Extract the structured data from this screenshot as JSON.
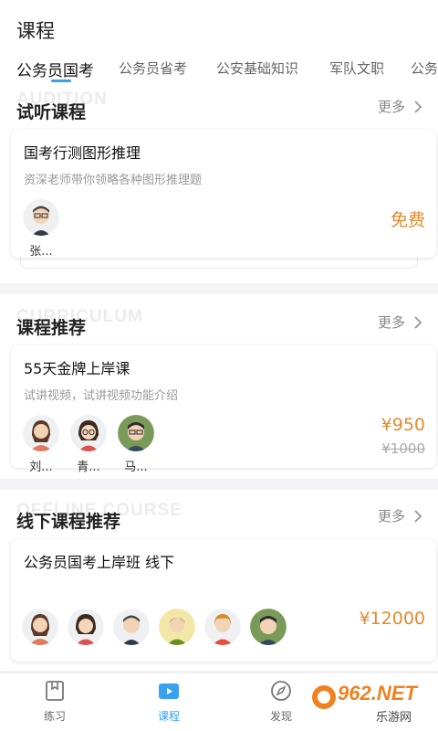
{
  "header": {
    "title": "课程"
  },
  "tabs": [
    {
      "label": "公务员国考",
      "active": true
    },
    {
      "label": "公务员省考",
      "active": false
    },
    {
      "label": "公安基础知识",
      "active": false
    },
    {
      "label": "军队文职",
      "active": false
    },
    {
      "label": "公务",
      "active": false
    }
  ],
  "more_label": "更多",
  "sections": {
    "trial": {
      "ghost": "AUDITION",
      "title": "试听课程",
      "card": {
        "title": "国考行测图形推理",
        "subtitle": "资深老师带你领略各种图形推理题",
        "teachers": [
          "张..."
        ],
        "price": "免费"
      }
    },
    "recommend": {
      "ghost": "CURRICULUM",
      "title": "课程推荐",
      "card": {
        "title": "55天金牌上岸课",
        "subtitle": "试讲视频，试讲视频功能介绍",
        "teachers": [
          "刘...",
          "青...",
          "马..."
        ],
        "price": "¥950",
        "original_price": "¥1000"
      }
    },
    "offline": {
      "ghost": "OFFLINE COURSE",
      "title": "线下课程推荐",
      "card": {
        "title": "公务员国考上岸班 线下",
        "price": "¥12000"
      }
    }
  },
  "tabbar": [
    {
      "label": "练习",
      "icon": "practice-book-icon",
      "active": false
    },
    {
      "label": "课程",
      "icon": "course-video-icon",
      "active": true
    },
    {
      "label": "发现",
      "icon": "compass-icon",
      "active": false
    }
  ],
  "watermark": {
    "main": "962.NET",
    "sub": "乐游网"
  },
  "colors": {
    "accent": "#3aa0f0",
    "price": "#e58a2e"
  }
}
